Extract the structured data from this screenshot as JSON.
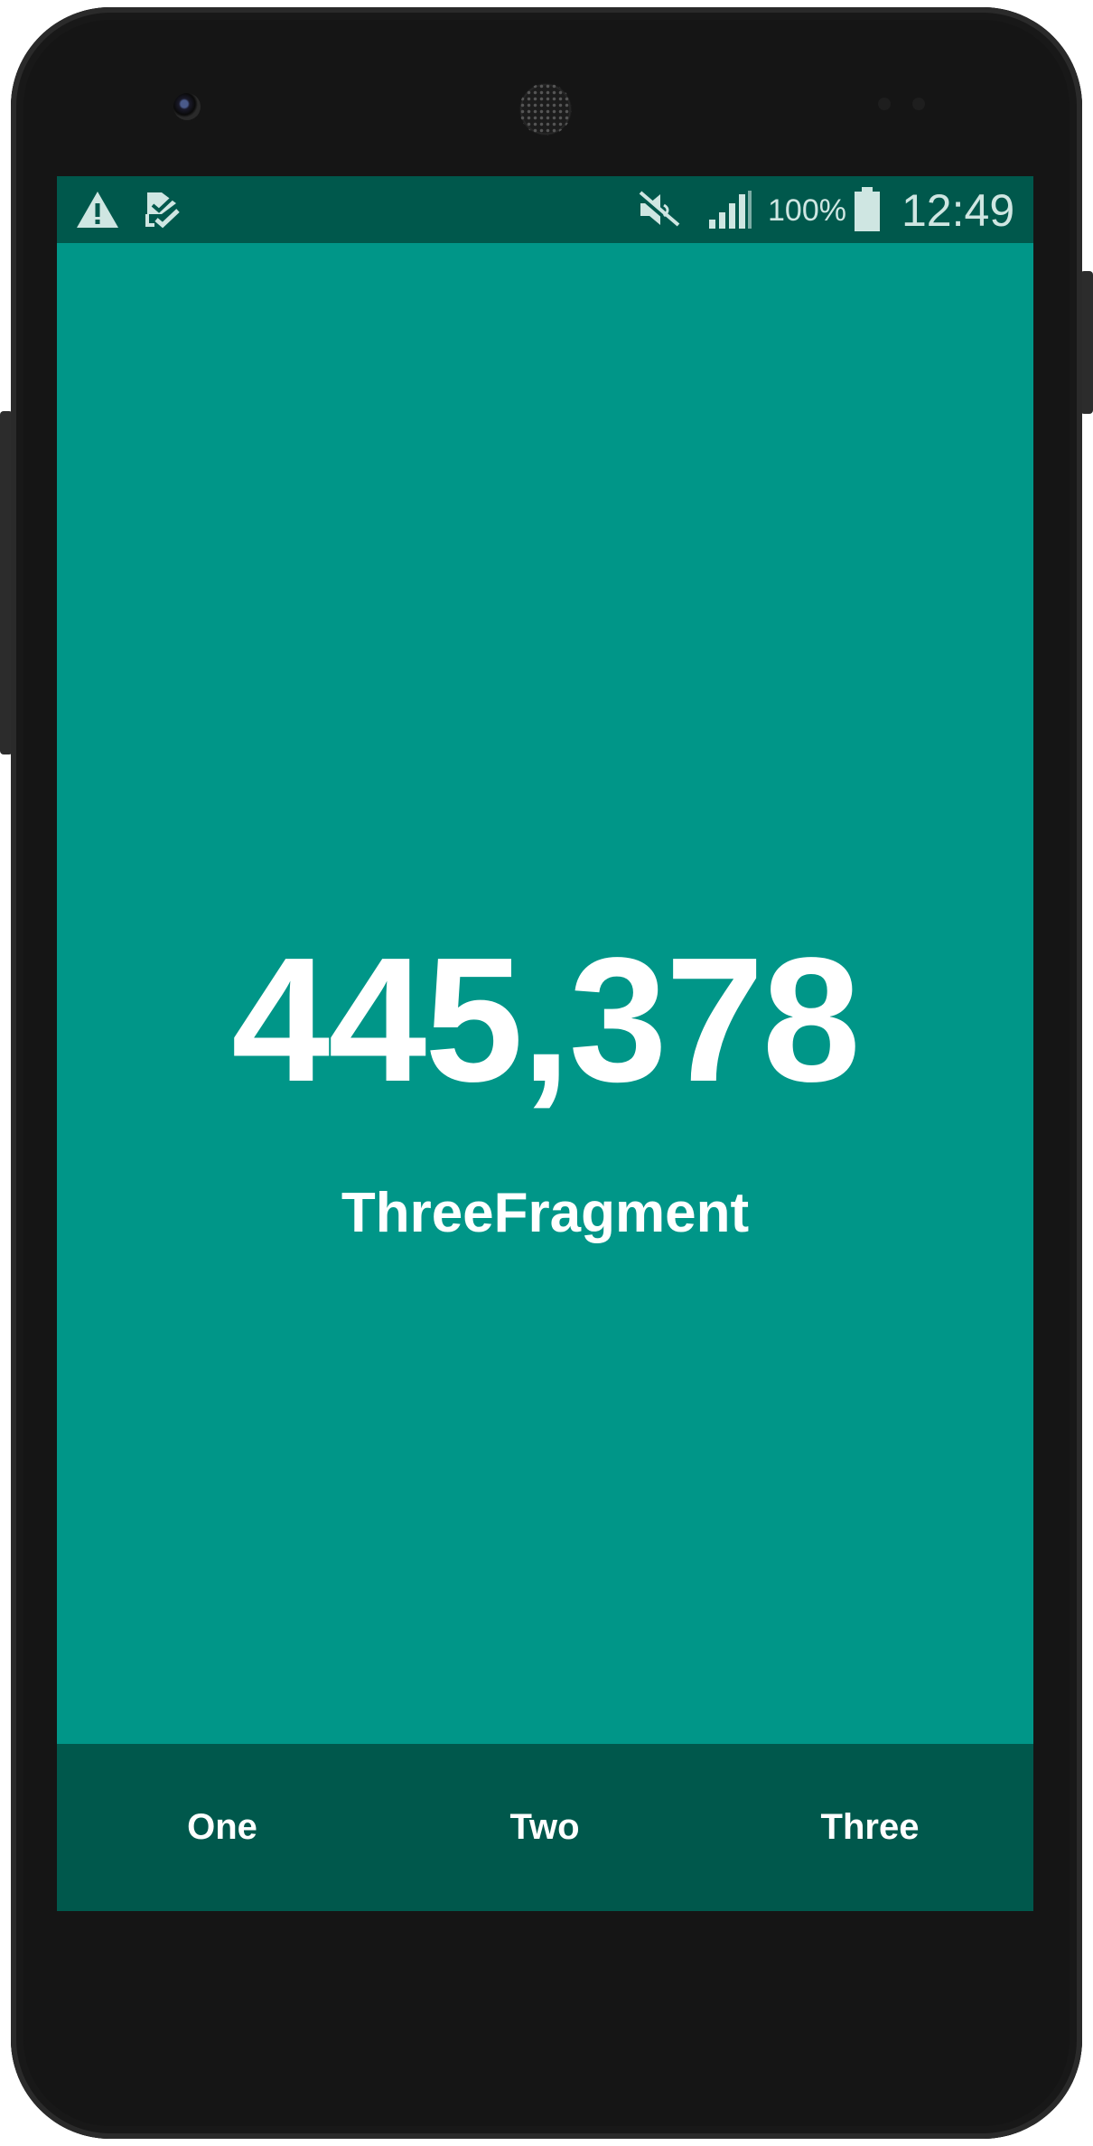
{
  "status_bar": {
    "battery_percent": "100%",
    "time": "12:49",
    "icons": [
      "warning-icon",
      "task-check-icon",
      "mute-icon",
      "signal-icon",
      "battery-icon"
    ]
  },
  "content": {
    "counter": "445,378",
    "fragment_label": "ThreeFragment"
  },
  "bottom_nav": {
    "items": [
      {
        "label": "One"
      },
      {
        "label": "Two"
      },
      {
        "label": "Three"
      }
    ]
  },
  "colors": {
    "primary": "#009688",
    "primary_dark": "#00584c",
    "text": "#ffffff"
  }
}
